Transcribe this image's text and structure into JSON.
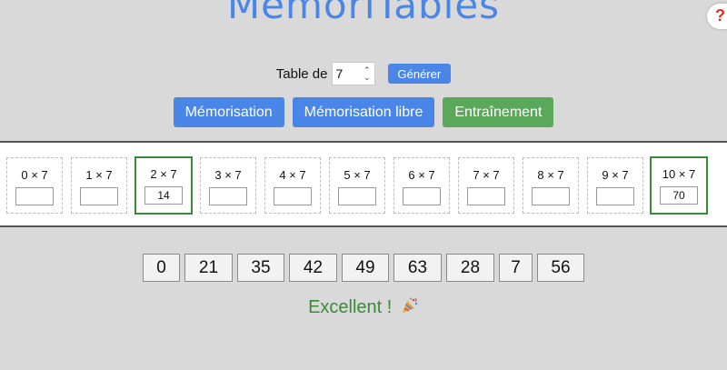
{
  "app": {
    "title": "MémoriTables",
    "corner_badge": "?"
  },
  "controls": {
    "table_label": "Table de",
    "table_value": "7",
    "generate_label": "Générer"
  },
  "modes": [
    {
      "label": "Mémorisation",
      "color": "#4a86e8"
    },
    {
      "label": "Mémorisation libre",
      "color": "#4a86e8"
    },
    {
      "label": "Entraînement",
      "color": "#5aa85a"
    }
  ],
  "cards": [
    {
      "label": "0 × 7",
      "value": ""
    },
    {
      "label": "1 × 7",
      "value": ""
    },
    {
      "label": "2 × 7",
      "value": "14",
      "correct": true
    },
    {
      "label": "3 × 7",
      "value": ""
    },
    {
      "label": "4 × 7",
      "value": ""
    },
    {
      "label": "5 × 7",
      "value": ""
    },
    {
      "label": "6 × 7",
      "value": ""
    },
    {
      "label": "7 × 7",
      "value": ""
    },
    {
      "label": "8 × 7",
      "value": ""
    },
    {
      "label": "9 × 7",
      "value": ""
    },
    {
      "label": "10 × 7",
      "value": "70",
      "correct": true
    }
  ],
  "answers": [
    "0",
    "21",
    "35",
    "42",
    "49",
    "63",
    "28",
    "7",
    "56"
  ],
  "feedback": {
    "text": "Excellent !",
    "icon": "party-popper-icon",
    "color": "#3a8a3a"
  }
}
